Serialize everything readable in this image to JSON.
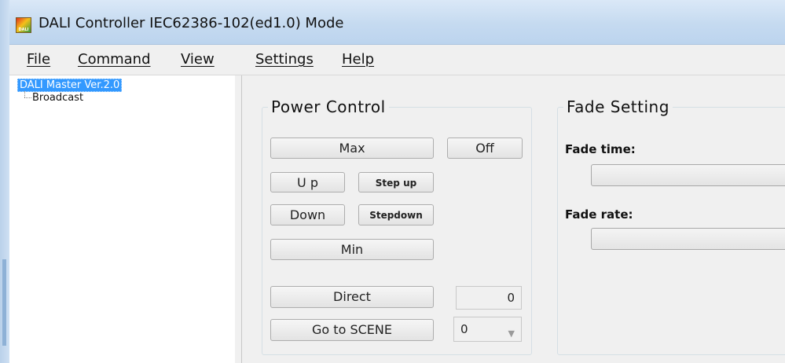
{
  "window": {
    "title": "DALI Controller IEC62386-102(ed1.0) Mode",
    "icon_text": "DALI"
  },
  "menu": {
    "items": [
      {
        "label": "File"
      },
      {
        "label": "Command"
      },
      {
        "label": "View"
      },
      {
        "label": "Settings"
      },
      {
        "label": "Help"
      }
    ]
  },
  "tree": {
    "root": "DALI Master Ver.2.0",
    "children": [
      "Broadcast"
    ]
  },
  "power_control": {
    "title": "Power Control",
    "max_label": "Max",
    "off_label": "Off",
    "up_label": "U p",
    "step_up_label": "Step up",
    "down_label": "Down",
    "step_down_label": "Stepdown",
    "min_label": "Min",
    "direct_label": "Direct",
    "direct_value": "0",
    "go_to_scene_label": "Go to SCENE",
    "scene_value": "0"
  },
  "fade_setting": {
    "title": "Fade Setting",
    "fade_time_label": "Fade time:",
    "fade_rate_label": "Fade rate:"
  },
  "colors": {
    "selection": "#3399ff",
    "titlebar": "#c5daf0",
    "background": "#f0f0f0"
  }
}
